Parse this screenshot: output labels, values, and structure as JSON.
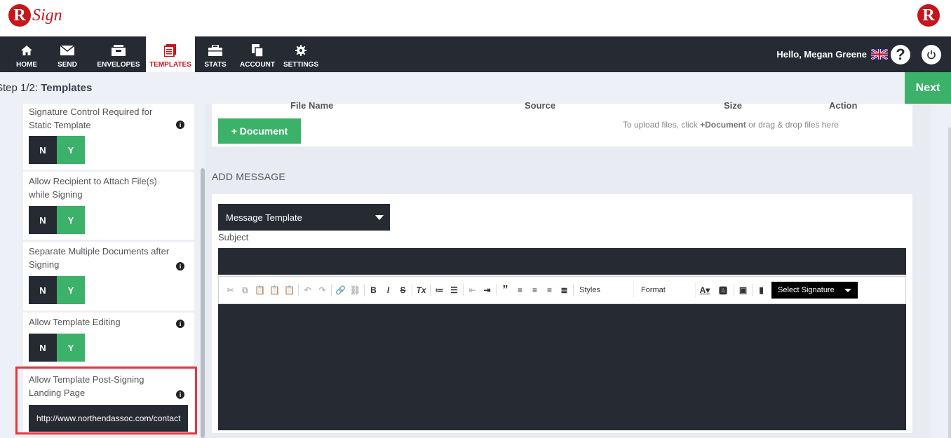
{
  "header": {
    "logo_text": "Sign",
    "logo_letter": "R"
  },
  "nav": {
    "items": [
      {
        "label": "HOME",
        "icon": "home-icon"
      },
      {
        "label": "SEND",
        "icon": "envelope-icon"
      },
      {
        "label": "ENVELOPES",
        "icon": "inbox-icon"
      },
      {
        "label": "TEMPLATES",
        "icon": "templates-icon",
        "active": true
      },
      {
        "label": "STATS",
        "icon": "briefcase-icon"
      },
      {
        "label": "ACCOUNT",
        "icon": "account-icon"
      },
      {
        "label": "SETTINGS",
        "icon": "gear-icon"
      }
    ],
    "greeting": "Hello, Megan Greene",
    "help_glyph": "?"
  },
  "stepbar": {
    "prefix": "Step 1/2: ",
    "title": "Templates",
    "next_label": "Next"
  },
  "options": [
    {
      "label": "Signature Control Required for Static Template",
      "no": "N",
      "yes": "Y",
      "info": "i"
    },
    {
      "label": "Allow Recipient to Attach File(s) while Signing",
      "no": "N",
      "yes": "Y",
      "info": "i"
    },
    {
      "label": "Separate Multiple Documents after Signing",
      "no": "N",
      "yes": "Y",
      "info": "i"
    },
    {
      "label": "Allow Template Editing",
      "no": "N",
      "yes": "Y",
      "info": "i"
    },
    {
      "label": "Allow Template Post-Signing Landing Page",
      "info": "i",
      "url_value": "http://www.northendassoc.com/contact"
    }
  ],
  "documents": {
    "columns": {
      "file_name": "File Name",
      "source": "Source",
      "size": "Size",
      "action": "Action"
    },
    "add_button": "+ Document",
    "hint_prefix": "To upload files, click ",
    "hint_bold": "+Document",
    "hint_suffix": " or drag & drop files here"
  },
  "message": {
    "section_title": "ADD MESSAGE",
    "template_select": "Message Template",
    "subject_label": "Subject",
    "subject_value": "",
    "toolbar": {
      "styles": "Styles",
      "format": "Format",
      "select_signature": "Select Signature"
    }
  },
  "colors": {
    "brand_red": "#c4161c",
    "nav_dark": "#252a33",
    "green": "#3bb16a",
    "highlight": "#e0393e"
  }
}
